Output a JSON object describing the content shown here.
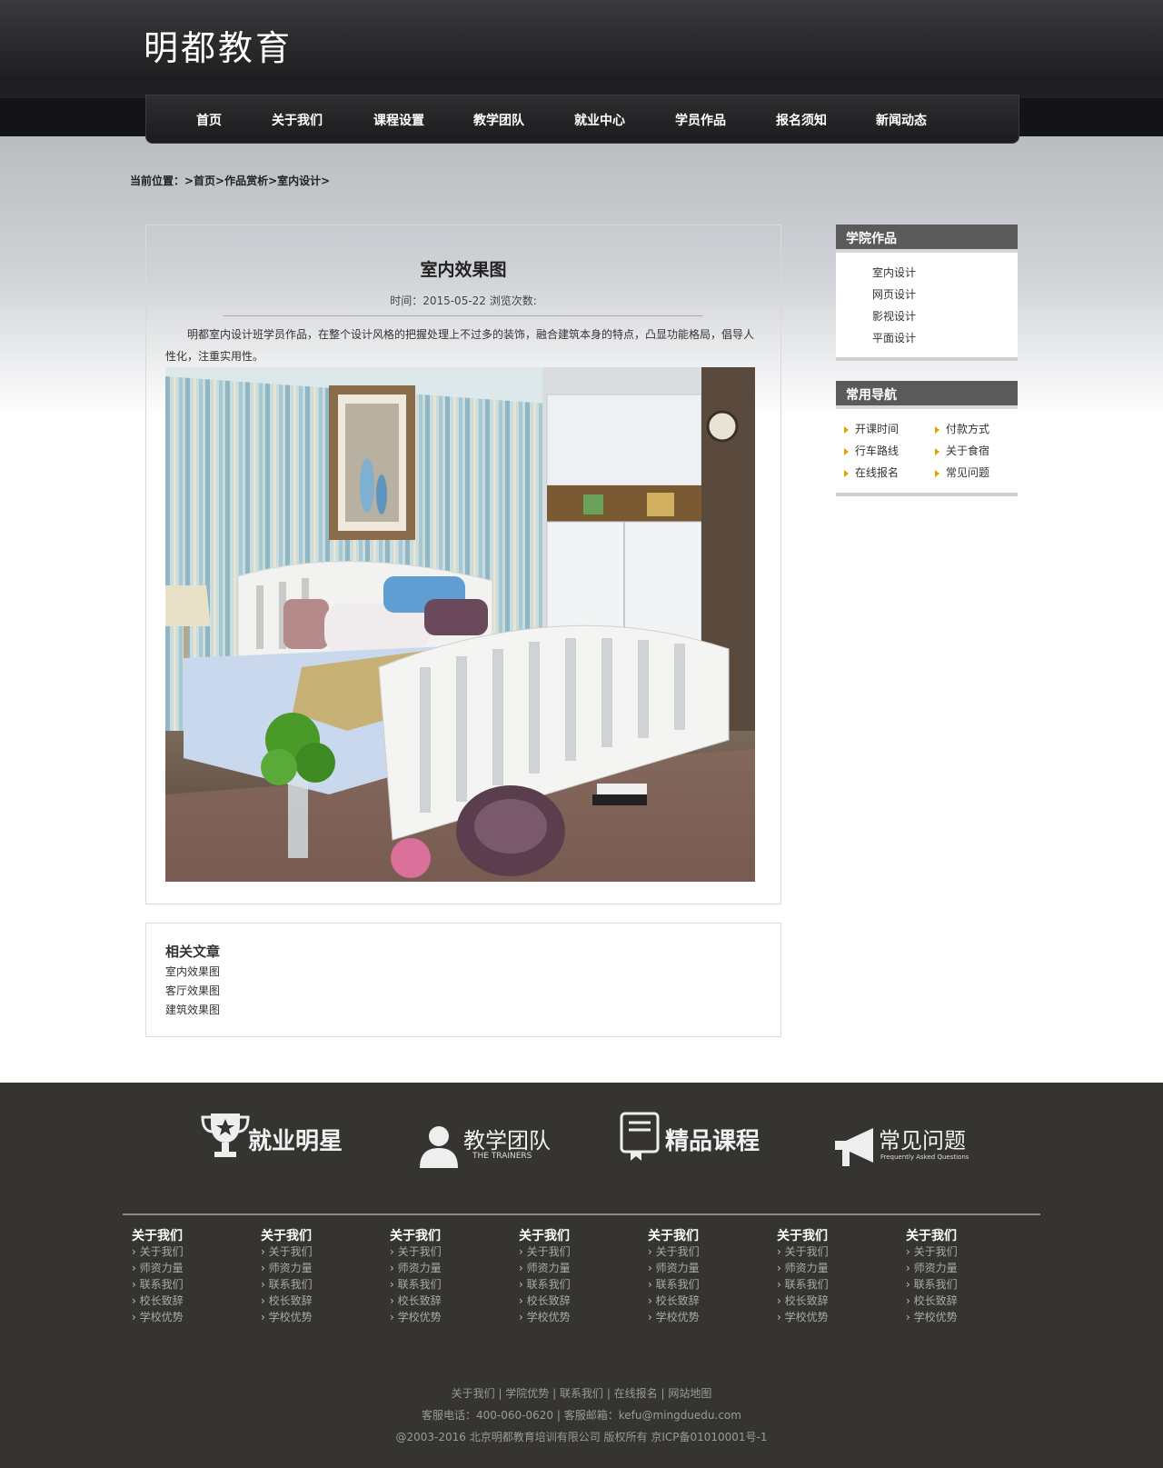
{
  "header": {
    "logo": "明都教育"
  },
  "nav": [
    "首页",
    "关于我们",
    "课程设置",
    "教学团队",
    "就业中心",
    "学员作品",
    "报名须知",
    "新闻动态"
  ],
  "breadcrumb": "当前位置：>首页>作品赏析>室内设计>",
  "article": {
    "title": "室内效果图",
    "meta": "时间：2015-05-22 浏览次数:",
    "description": "明都室内设计班学员作品，在整个设计风格的把握处理上不过多的装饰，融合建筑本身的特点，凸显功能格局，倡导人性化，注重实用性。",
    "image_alt": "bedroom interior rendering"
  },
  "related": {
    "title": "相关文章",
    "items": [
      "室内效果图",
      "客厅效果图",
      "建筑效果图"
    ]
  },
  "sidebar": {
    "works": {
      "title": "学院作品",
      "items": [
        "室内设计",
        "网页设计",
        "影视设计",
        "平面设计"
      ]
    },
    "nav": {
      "title": "常用导航",
      "items": [
        "开课时间",
        "付款方式",
        "行车路线",
        "关于食宿",
        "在线报名",
        "常见问题"
      ]
    }
  },
  "footer": {
    "features": [
      {
        "label": "就业明星",
        "sub": "",
        "icon": "trophy-icon"
      },
      {
        "label": "教学团队",
        "sub": "THE TRAINERS",
        "icon": "person-icon"
      },
      {
        "label": "精品课程",
        "sub": "",
        "icon": "book-icon"
      },
      {
        "label": "常见问题",
        "sub": "Frequently Asked Questions",
        "icon": "megaphone-icon"
      }
    ],
    "columns": [
      {
        "title": "关于我们",
        "links": [
          "关于我们",
          "师资力量",
          "联系我们",
          "校长致辞",
          "学校优势"
        ]
      },
      {
        "title": "关于我们",
        "links": [
          "关于我们",
          "师资力量",
          "联系我们",
          "校长致辞",
          "学校优势"
        ]
      },
      {
        "title": "关于我们",
        "links": [
          "关于我们",
          "师资力量",
          "联系我们",
          "校长致辞",
          "学校优势"
        ]
      },
      {
        "title": "关于我们",
        "links": [
          "关于我们",
          "师资力量",
          "联系我们",
          "校长致辞",
          "学校优势"
        ]
      },
      {
        "title": "关于我们",
        "links": [
          "关于我们",
          "师资力量",
          "联系我们",
          "校长致辞",
          "学校优势"
        ]
      },
      {
        "title": "关于我们",
        "links": [
          "关于我们",
          "师资力量",
          "联系我们",
          "校长致辞",
          "学校优势"
        ]
      },
      {
        "title": "关于我们",
        "links": [
          "关于我们",
          "师资力量",
          "联系我们",
          "校长致辞",
          "学校优势"
        ]
      }
    ],
    "bottom_links": [
      "关于我们",
      "学院优势",
      "联系我们",
      "在线报名",
      "网站地图"
    ],
    "contact": "客服电话：400-060-0620 | 客服邮箱：kefu@mingduedu.com",
    "copyright": "@2003-2016 北京明都教育培训有限公司 版权所有 京ICP备01010001号-1"
  },
  "colors": {
    "header": "#1d1d1f",
    "footer": "#363431",
    "sidebar_header": "#5a5a5a",
    "bullet": "#e7a000"
  }
}
